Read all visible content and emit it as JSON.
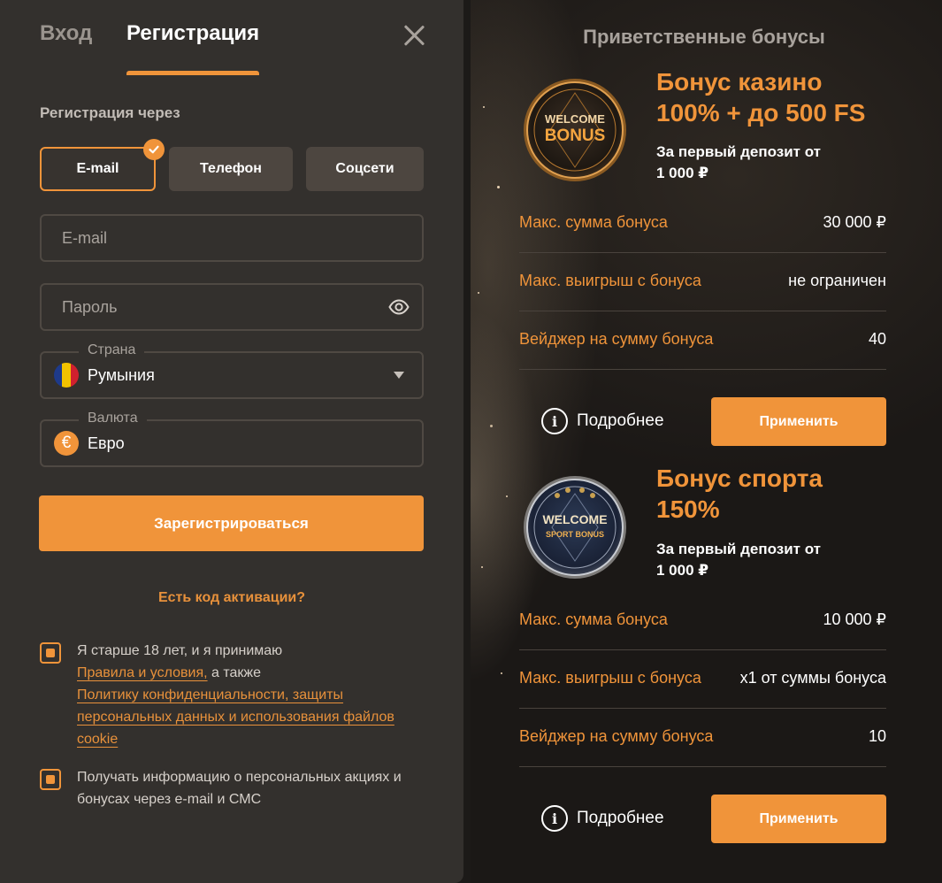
{
  "tabs": {
    "login": "Вход",
    "register": "Регистрация"
  },
  "register_via_label": "Регистрация через",
  "methods": {
    "email": "E-mail",
    "phone": "Телефон",
    "social": "Соцсети"
  },
  "fields": {
    "email_placeholder": "E-mail",
    "password_placeholder": "Пароль",
    "country_label": "Страна",
    "country_value": "Румыния",
    "currency_label": "Валюта",
    "currency_value": "Евро",
    "currency_symbol": "€"
  },
  "register_button": "Зарегистрироваться",
  "activation_link": "Есть код активации?",
  "consent": {
    "age_text": "Я старше 18 лет, и я принимаю",
    "rules_link": "Правила и условия,",
    "also_text": "а также",
    "privacy_link": "Политику конфиденциальности, защиты персональных данных и использования файлов cookie",
    "marketing_text": "Получать информацию о персональных акциях и бонусах через e-mail и СМС"
  },
  "bonuses_panel": {
    "title": "Приветственные бонусы",
    "casino": {
      "coin_line1": "WELCOME",
      "coin_line2": "BONUS",
      "title_line1": "Бонус казино",
      "title_line2": "100% + до 500 FS",
      "sub_line1": "За первый депозит от",
      "sub_line2": "1 000 ₽",
      "rows": [
        {
          "label": "Макс. сумма бонуса",
          "value": "30 000 ₽"
        },
        {
          "label": "Макс. выигрыш с бонуса",
          "value": "не ограничен"
        },
        {
          "label": "Вейджер на сумму бонуса",
          "value": "40"
        }
      ],
      "more": "Подробнее",
      "apply": "Применить"
    },
    "sport": {
      "coin_line1": "WELCOME",
      "coin_line2": "SPORT BONUS",
      "title_line1": "Бонус спорта",
      "title_line2": "150%",
      "sub_line1": "За первый депозит от",
      "sub_line2": "1 000 ₽",
      "rows": [
        {
          "label": "Макс. сумма бонуса",
          "value": "10 000 ₽"
        },
        {
          "label": "Макс. выигрыш с бонуса",
          "value": "x1 от суммы бонуса"
        },
        {
          "label": "Вейджер на сумму бонуса",
          "value": "10"
        }
      ],
      "more": "Подробнее",
      "apply": "Применить"
    }
  },
  "colors": {
    "accent": "#f0943a",
    "panel": "#33302d",
    "field_border": "#4f4943",
    "method_bg": "#4d4640"
  }
}
